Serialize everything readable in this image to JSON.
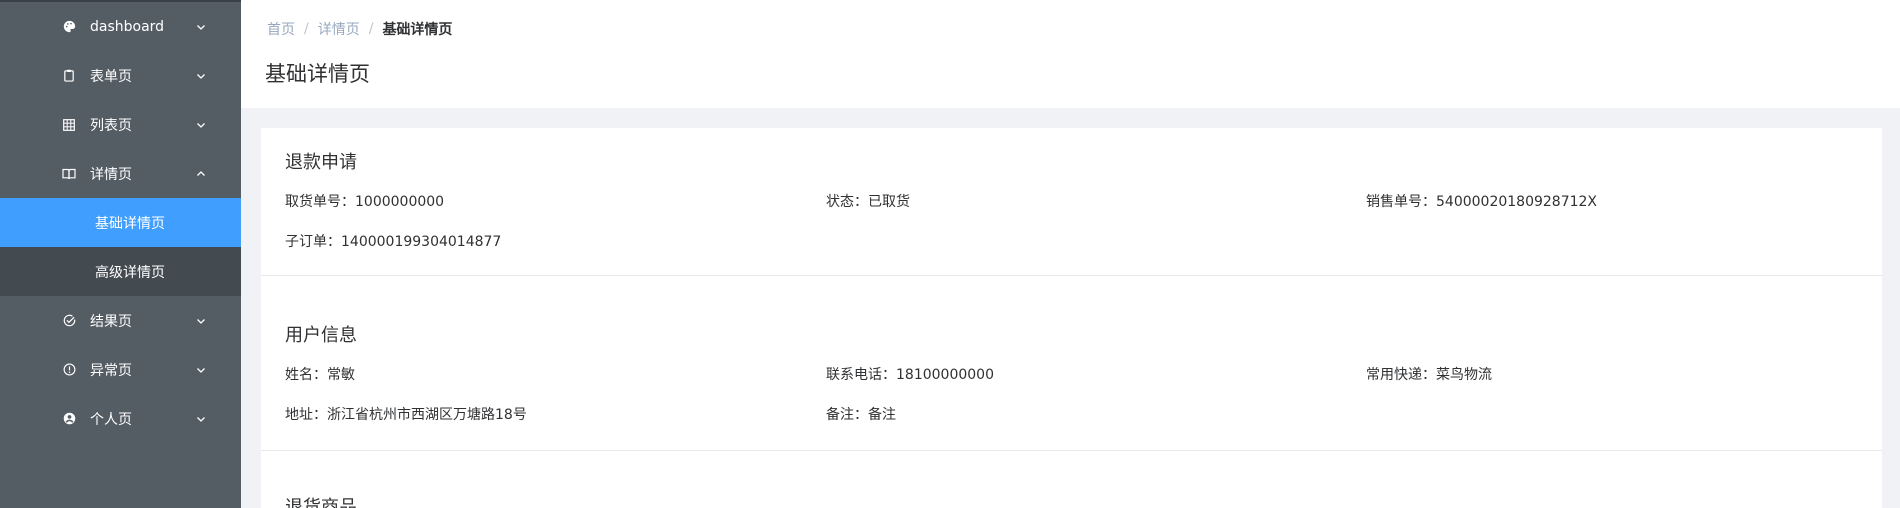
{
  "sidebar": {
    "items": [
      {
        "label": "dashboard",
        "icon": "palette-icon",
        "expanded": false
      },
      {
        "label": "表单页",
        "icon": "clipboard-icon",
        "expanded": false
      },
      {
        "label": "列表页",
        "icon": "grid-icon",
        "expanded": false
      },
      {
        "label": "详情页",
        "icon": "book-icon",
        "expanded": true,
        "children": [
          {
            "label": "基础详情页",
            "active": true
          },
          {
            "label": "高级详情页",
            "active": false
          }
        ]
      },
      {
        "label": "结果页",
        "icon": "check-circle-icon",
        "expanded": false
      },
      {
        "label": "异常页",
        "icon": "warning-circle-icon",
        "expanded": false
      },
      {
        "label": "个人页",
        "icon": "user-icon",
        "expanded": false
      }
    ]
  },
  "header": {
    "breadcrumb": [
      "首页",
      "详情页",
      "基础详情页"
    ],
    "separator": "/",
    "title": "基础详情页"
  },
  "refund": {
    "title": "退款申请",
    "fields": [
      {
        "text": "取货单号：1000000000"
      },
      {
        "text": "状态：已取货"
      },
      {
        "text": "销售单号：54000020180928712X"
      },
      {
        "text": "子订单：140000199304014877"
      }
    ]
  },
  "user": {
    "title": "用户信息",
    "fields": [
      {
        "text": "姓名：常敏"
      },
      {
        "text": "联系电话：18100000000"
      },
      {
        "text": "常用快递：菜鸟物流"
      },
      {
        "text": "地址：浙江省杭州市西湖区万塘路18号"
      },
      {
        "text": "备注：备注"
      }
    ]
  },
  "goods": {
    "title": "退货商品"
  },
  "colors": {
    "sidebar_bg": "#545c64",
    "active_bg": "#409eff",
    "submenu_bg": "#434a50"
  }
}
